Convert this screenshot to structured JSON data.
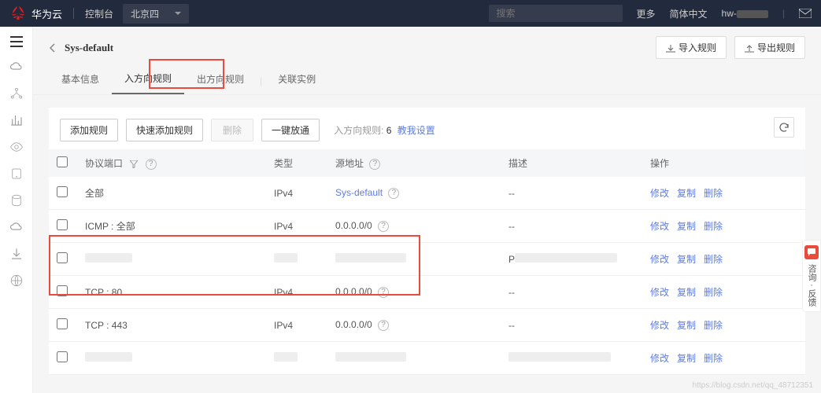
{
  "header": {
    "brand": "华为云",
    "console": "控制台",
    "region": "北京四",
    "search_placeholder": "搜索",
    "more": "更多",
    "lang": "简体中文",
    "user_prefix": "hw-"
  },
  "page": {
    "title": "Sys-default",
    "import_btn": "导入规则",
    "export_btn": "导出规则"
  },
  "tabs": [
    {
      "label": "基本信息",
      "active": false
    },
    {
      "label": "入方向规则",
      "active": true
    },
    {
      "label": "出方向规则",
      "active": false
    },
    {
      "label": "关联实例",
      "active": false
    }
  ],
  "toolbar": {
    "add": "添加规则",
    "quick_add": "快速添加规则",
    "delete": "删除",
    "allow_all": "一键放通",
    "info_label": "入方向规则:",
    "info_count": "6",
    "info_link": "教我设置"
  },
  "table": {
    "headers": {
      "proto": "协议端口",
      "type": "类型",
      "src": "源地址",
      "desc": "描述",
      "action": "操作"
    },
    "actions": {
      "modify": "修改",
      "copy": "复制",
      "delete": "删除"
    },
    "rows": [
      {
        "proto": "全部",
        "type": "IPv4",
        "src": "Sys-default",
        "src_link": true,
        "desc": "--"
      },
      {
        "proto": "ICMP : 全部",
        "type": "IPv4",
        "src": "0.0.0.0/0",
        "src_help": true,
        "desc": "--"
      },
      {
        "proto": "",
        "type": "",
        "src": "",
        "desc_prefix": "P",
        "blur": true
      },
      {
        "proto": "TCP : 80",
        "type": "IPv4",
        "src": "0.0.0.0/0",
        "src_help": true,
        "desc": "--"
      },
      {
        "proto": "TCP : 443",
        "type": "IPv4",
        "src": "0.0.0.0/0",
        "src_help": true,
        "desc": "--"
      },
      {
        "proto": "",
        "type": "",
        "src": "",
        "blur": true
      }
    ]
  },
  "feedback": {
    "label": "咨询 · 反馈"
  },
  "watermark": "https://blog.csdn.net/qq_48712351"
}
